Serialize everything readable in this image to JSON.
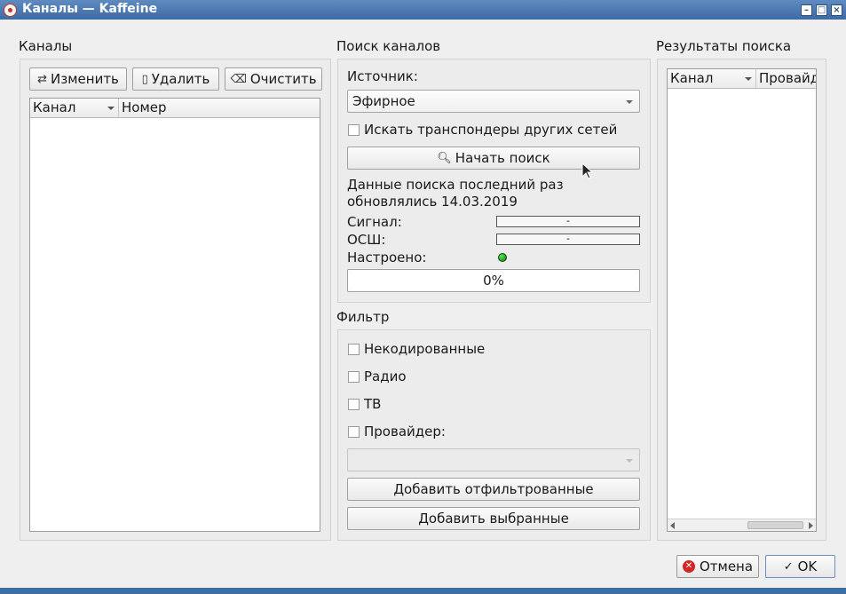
{
  "window": {
    "title": "Каналы — Kaffeine"
  },
  "channels": {
    "section_title": "Каналы",
    "edit_label": "Изменить",
    "delete_label": "Удалить",
    "clear_label": "Очистить",
    "columns": [
      "Канал",
      "Номер"
    ]
  },
  "search": {
    "section_title": "Поиск каналов",
    "source_label": "Источник:",
    "source_value": "Эфирное",
    "other_networks_label": "Искать транспондеры других сетей",
    "start_label": "Начать поиск",
    "last_update_line1": "Данные поиска последний раз",
    "last_update_line2": "обновлялись 14.03.2019",
    "signal_label": "Сигнал:",
    "signal_value": "-",
    "snr_label": "ОСШ:",
    "snr_value": "-",
    "tuned_label": "Настроено:",
    "progress": "0%"
  },
  "filter": {
    "section_title": "Фильтр",
    "unscrambled": "Некодированные",
    "radio": "Радио",
    "tv": "ТВ",
    "provider": "Провайдер:",
    "provider_value": "",
    "add_filtered": "Добавить отфильтрованные",
    "add_selected": "Добавить выбранные"
  },
  "results": {
    "section_title": "Результаты поиска",
    "columns": [
      "Канал",
      "Провайд"
    ]
  },
  "dialog": {
    "cancel_label": "Отмена",
    "ok_label": "OK"
  },
  "colors": {
    "titlebar": "#3c6aa5",
    "tuned_led": "#1a9a1a",
    "cancel_icon": "#d32626"
  }
}
